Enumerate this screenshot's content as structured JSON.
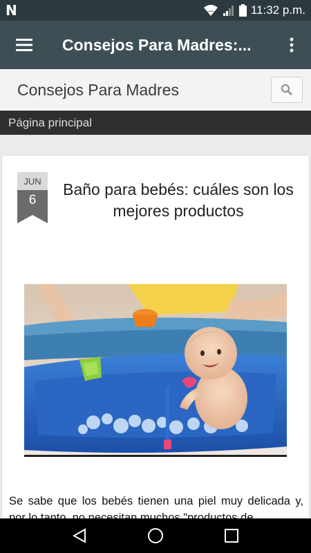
{
  "status_bar": {
    "app_icon": "N",
    "time": "11:32 p.m.",
    "icons": [
      "wifi-icon",
      "signal-icon",
      "battery-icon"
    ]
  },
  "app_bar": {
    "title": "Consejos Para Madres:...",
    "menu_icon": "hamburger-menu-icon",
    "more_icon": "more-vert-icon"
  },
  "site_header": {
    "title": "Consejos Para Madres",
    "search_icon": "search-icon"
  },
  "nav": {
    "label": "Página principal"
  },
  "post": {
    "date_month": "JUN",
    "date_day": "6",
    "title": "Baño para bebés: cuáles son los mejores productos",
    "body": "Se sabe que los bebés tienen una piel muy delicada y, por lo tanto, no necesitan muchos \"productos de",
    "image_alt": "baby-bath-photo"
  },
  "system_nav": {
    "back_icon": "back-triangle-icon",
    "home_icon": "home-circle-icon",
    "recents_icon": "recents-square-icon"
  },
  "colors": {
    "status_bar": "#2c3a3f",
    "app_bar": "#3d4f55",
    "nav_bar": "#2f2f2f",
    "date_badge": "#6b6b6b"
  }
}
